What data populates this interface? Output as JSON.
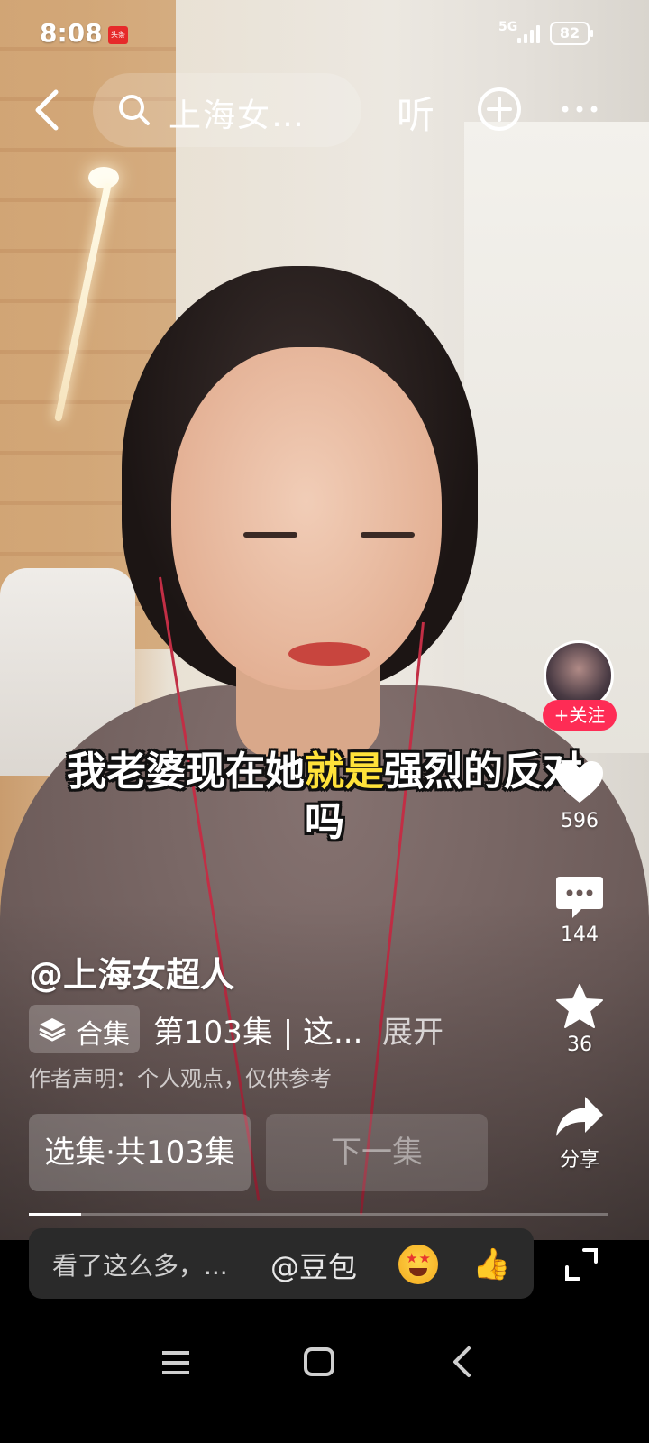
{
  "status_bar": {
    "time": "8:08",
    "notification_app": "头条",
    "network": "5G",
    "battery": "82"
  },
  "top_bar": {
    "search_text": "上海女…",
    "listen_label": "听",
    "icons": [
      "back-icon",
      "search-icon",
      "plus-circle-icon",
      "more-icon"
    ]
  },
  "subtitle": {
    "before": "我老婆现在她",
    "highlight": "就是",
    "after": "强烈的反对吗"
  },
  "right_rail": {
    "follow_label": "+关注",
    "likes": "596",
    "comments": "144",
    "favorites": "36",
    "share_label": "分享"
  },
  "info": {
    "author": "@上海女超人",
    "collection_label": "合集",
    "episode_title": "第103集 | 这...",
    "expand_label": "展开",
    "disclaimer": "作者声明：个人观点，仅供参考",
    "select_episodes": "选集·共103集",
    "next_episode": "下一集",
    "progress": 0.09
  },
  "comment_bar": {
    "placeholder": "看了这么多，...",
    "mention": "@豆包"
  },
  "colors": {
    "accent": "#fe2c55",
    "subtitle_highlight": "#ffe23a"
  }
}
